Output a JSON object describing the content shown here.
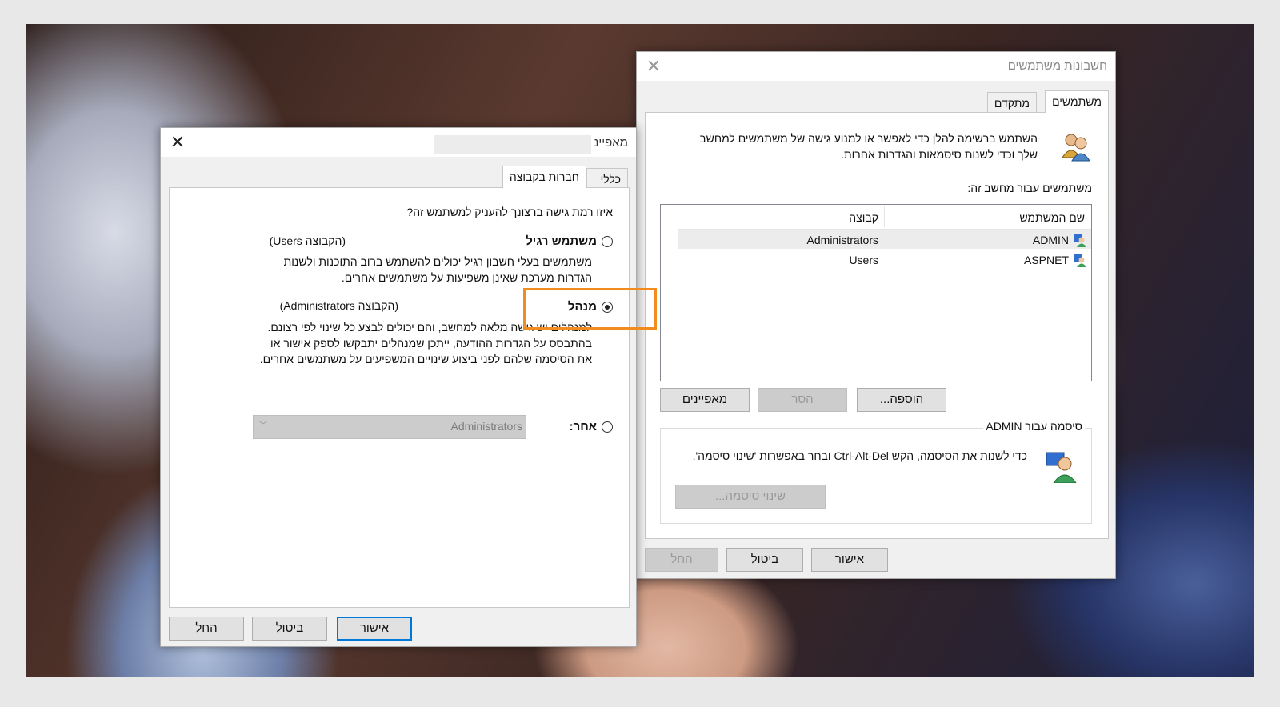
{
  "users_window": {
    "title": "חשבונות משתמשים",
    "tabs": [
      {
        "label": "משתמשים"
      },
      {
        "label": "מתקדם"
      }
    ],
    "intro_text": "השתמש ברשימה להלן כדי לאפשר או למנוע גישה של משתמשים למחשב שלך וכדי לשנות סיסמאות והגדרות אחרות.",
    "list_label": "משתמשים עבור מחשב זה:",
    "columns": {
      "username": "שם המשתמש",
      "group": "קבוצה"
    },
    "rows": [
      {
        "username": "ADMIN",
        "group": "Administrators"
      },
      {
        "username": "ASPNET",
        "group": "Users"
      }
    ],
    "buttons": {
      "add": "הוספה...",
      "remove": "הסר",
      "properties": "מאפיינים"
    },
    "password_group_title": "סיסמה עבור ADMIN",
    "password_text": "כדי לשנות את הסיסמה, הקש Ctrl-Alt-Del ובחר באפשרות 'שינוי סיסמה'.",
    "change_password": "שינוי סיסמה...",
    "footer": {
      "ok": "אישור",
      "cancel": "ביטול",
      "apply": "החל"
    }
  },
  "props_window": {
    "title": "מאפיינ",
    "tabs": [
      {
        "label": "כללי"
      },
      {
        "label": "חברות בקבוצה"
      }
    ],
    "question": "איזו רמת גישה ברצונך להעניק למשתמש זה?",
    "options": [
      {
        "label": "משתמש רגיל",
        "group": "(הקבוצה Users)",
        "desc": "משתמשים בעלי חשבון רגיל יכולים להשתמש ברוב התוכנות ולשנות הגדרות מערכת שאינן משפיעות על משתמשים אחרים.",
        "checked": false
      },
      {
        "label": "מנהל",
        "group": "(הקבוצה Administrators)",
        "desc": "למנהלים יש גישה מלאה למחשב, והם יכולים לבצע כל שינוי לפי רצונם. בהתבסס על הגדרות ההודעה, ייתכן שמנהלים יתבקשו לספק אישור או את הסיסמה שלהם לפני ביצוע שינויים המשפיעים על משתמשים אחרים.",
        "checked": true
      },
      {
        "label": "אחר:",
        "checked": false
      }
    ],
    "other_select_value": "Administrators",
    "footer": {
      "ok": "אישור",
      "cancel": "ביטול",
      "apply": "החל"
    }
  },
  "highlight_color": "#f28c1e",
  "accent_color": "#0078d7"
}
